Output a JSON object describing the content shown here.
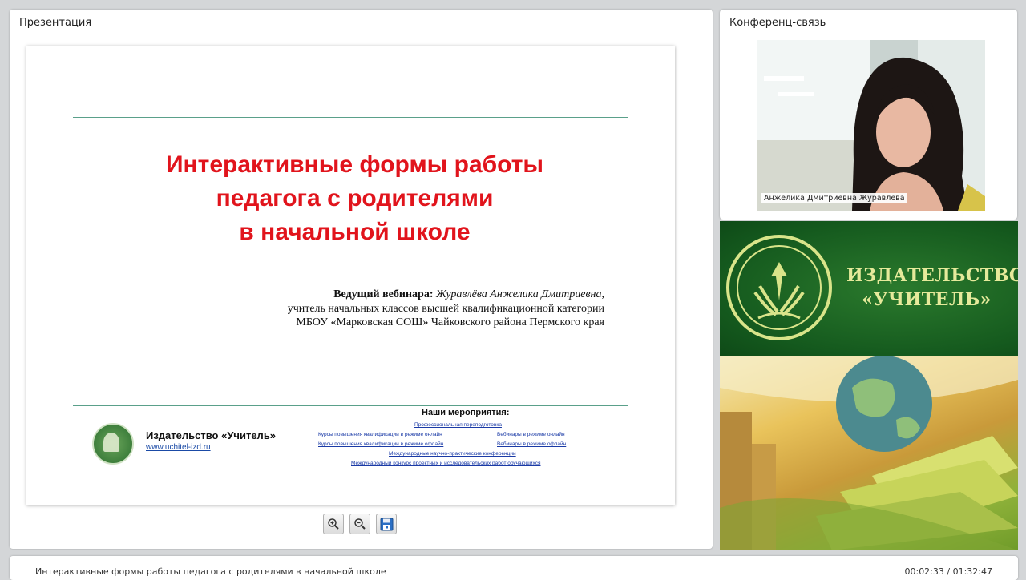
{
  "panels": {
    "presentation_title": "Презентация",
    "conference_title": "Конференц-связь"
  },
  "slide": {
    "title_lines": [
      "Интерактивные формы работы",
      "педагога с родителями",
      "в начальной школе"
    ],
    "host_label": "Ведущий вебинара:",
    "host_name": "Журавлёва Анжелика Дмитриевна",
    "host_line2": "учитель начальных классов высшей квалификационной категории",
    "host_line3": "МБОУ «Марковская СОШ» Чайковского района Пермского края",
    "publisher_name": "Издательство «Учитель»",
    "publisher_url": "www.uchitel-izd.ru",
    "events_title": "Наши мероприятия",
    "events": [
      "Профессиональная переподготовка",
      "Курсы повышения квалификации в режиме онлайн",
      "Вебинары в режиме онлайн",
      "Курсы повышения квалификации в режиме офлайн",
      "Вебинары в режиме офлайн",
      "Международные научно-практические конференции",
      "Международный конкурс проектных и исследовательских работ обучающихся"
    ]
  },
  "toolbar": {
    "zoom_in_icon": "zoom-in-icon",
    "zoom_out_icon": "zoom-out-icon",
    "save_icon": "save-icon"
  },
  "webcam": {
    "participant_name": "Анжелика Дмитриевна Журавлева"
  },
  "banner": {
    "line1": "ИЗДАТЕЛЬСТВО",
    "line2": "«УЧИТЕЛЬ»"
  },
  "footer": {
    "webinar_title": "Интерактивные формы работы педагога с родителями в начальной школе",
    "time": "00:02:33 / 01:32:47"
  },
  "colors": {
    "title_red": "#e1141c",
    "brand_green": "#155a1e",
    "banner_text": "#e6ea9b"
  }
}
